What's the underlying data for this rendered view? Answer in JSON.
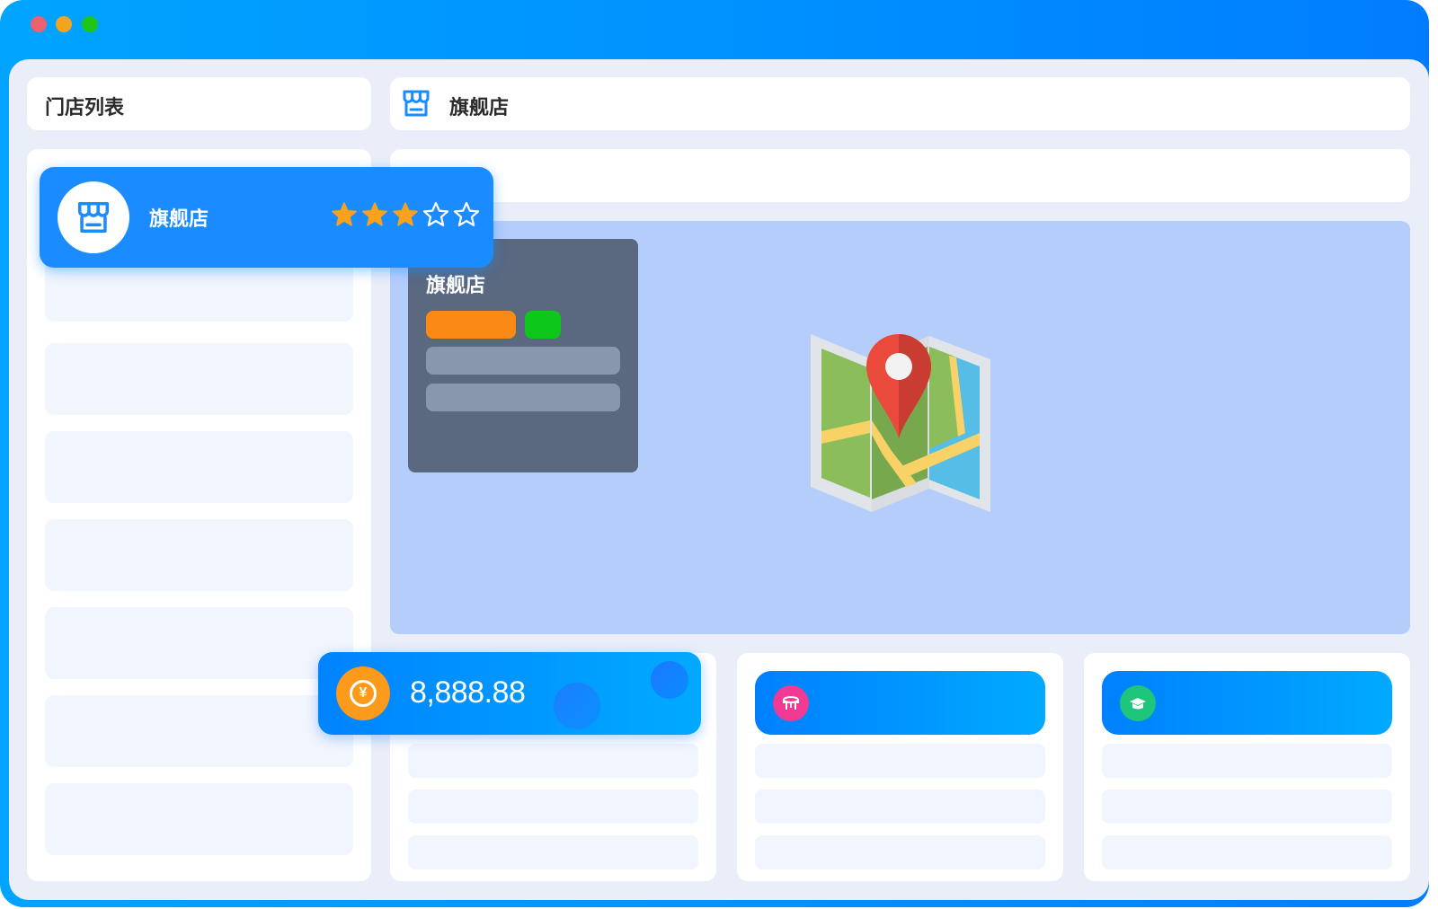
{
  "window": {
    "controls": [
      "close",
      "minimize",
      "maximize"
    ]
  },
  "sidebar": {
    "title": "门店列表",
    "selected_store": {
      "name": "旗舰店",
      "icon": "store-icon",
      "rating": 3,
      "rating_max": 5
    }
  },
  "detail": {
    "title": "旗舰店",
    "title_icon": "store-icon"
  },
  "map": {
    "popup_title": "旗舰店",
    "icon": "map-pin-icon"
  },
  "stats": {
    "revenue_value": "8,888.88",
    "revenue_icon": "yuan-coin-icon",
    "table_icon": "table-icon",
    "chef_icon": "chef-hat-icon"
  },
  "colors": {
    "accent": "#1a8cff",
    "star": "#fba21b",
    "orange_tag": "#fb8a15",
    "green_tag": "#0dc81a",
    "map_bg": "#b5cdfb"
  }
}
